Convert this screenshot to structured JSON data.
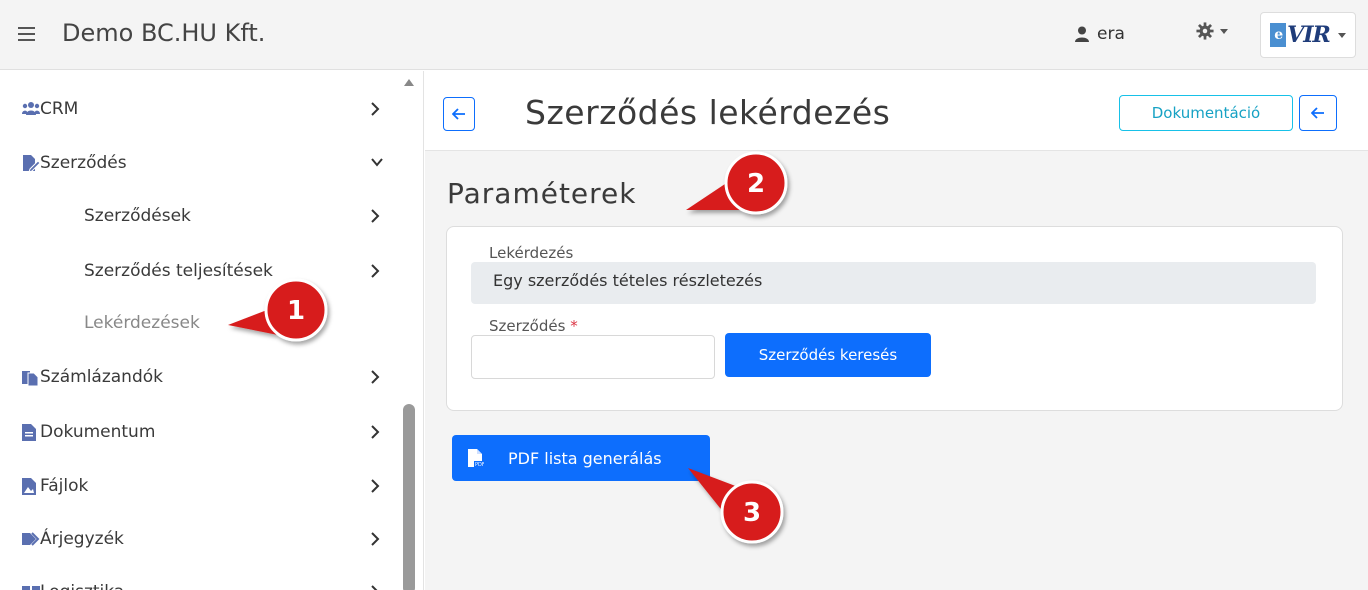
{
  "topbar": {
    "title": "Demo BC.HU Kft.",
    "user": "era",
    "logo_text": "VIR",
    "logo_e": "e"
  },
  "sidebar": {
    "items": [
      {
        "label": "CRM",
        "icon": "users-icon"
      },
      {
        "label": "Szerződés",
        "icon": "contract-edit-icon"
      },
      {
        "label": "Szerződések"
      },
      {
        "label": "Szerződés teljesítések"
      },
      {
        "label": "Lekérdezések"
      },
      {
        "label": "Számlázandók",
        "icon": "files-icon"
      },
      {
        "label": "Dokumentum",
        "icon": "file-icon"
      },
      {
        "label": "Fájlok",
        "icon": "image-file-icon"
      },
      {
        "label": "Árjegyzék",
        "icon": "tags-icon"
      },
      {
        "label": "Logisztika",
        "icon": "logistics-icon"
      }
    ]
  },
  "main": {
    "title": "Szerződés lekérdezés",
    "doc_button": "Dokumentáció",
    "section_title": "Paraméterek",
    "query_label": "Lekérdezés",
    "query_value": "Egy szerződés tételes részletezés",
    "contract_label": "Szerződés",
    "required_mark": "*",
    "search_button": "Szerződés keresés",
    "pdf_button": "PDF lista generálás"
  },
  "callouts": [
    "1",
    "2",
    "3"
  ],
  "colors": {
    "primary": "#0d6efd",
    "info": "#17c1e8",
    "callout": "#d71a1a"
  }
}
